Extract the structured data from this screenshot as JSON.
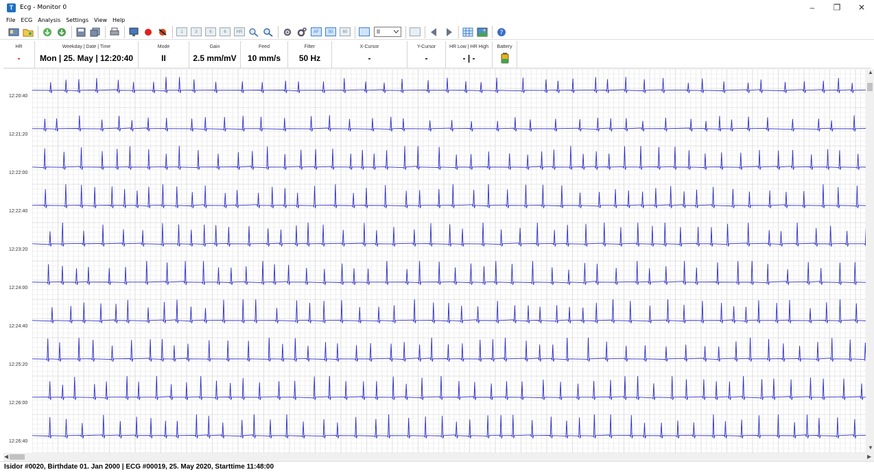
{
  "window": {
    "title": "Ecg - Monitor 0",
    "app_icon_letter": "T",
    "minimize": "–",
    "maximize": "❐",
    "close": "✕"
  },
  "menu": [
    "File",
    "ECG",
    "Analysis",
    "Settings",
    "View",
    "Help"
  ],
  "toolbar": {
    "box_labels": [
      "1",
      "3",
      "6",
      "6",
      "HR"
    ],
    "af_label": "AF",
    "b50_label": "50",
    "b60_label": "60",
    "lead_select": "II"
  },
  "header": {
    "hr_label": "HR",
    "hr_value": "-",
    "datetime_label": "Weekday | Date | Time",
    "datetime_value": "Mon | 25. May | 12:20:40",
    "mode_label": "Mode",
    "mode_value": "II",
    "gain_label": "Gain",
    "gain_value": "2.5 mm/mV",
    "feed_label": "Feed",
    "feed_value": "10 mm/s",
    "filter_label": "Filter",
    "filter_value": "50 Hz",
    "xcursor_label": "X-Cursor",
    "xcursor_value": "-",
    "ycursor_label": "Y-Cursor",
    "ycursor_value": "-",
    "hrlowhigh_label": "HR Low | HR High",
    "hrlowhigh_value": "- | -",
    "battery_label": "Battery"
  },
  "strips": [
    {
      "time": "12:20:40"
    },
    {
      "time": "12:21:20"
    },
    {
      "time": "12:22:00"
    },
    {
      "time": "12:22:40"
    },
    {
      "time": "12:23:20"
    },
    {
      "time": "12:24:00"
    },
    {
      "time": "12:24:40"
    },
    {
      "time": "12:25:20"
    },
    {
      "time": "12:26:00"
    },
    {
      "time": "12:26:40"
    }
  ],
  "status": {
    "text": "Isidor #0020, Birthdate 01. Jan 2000 | ECG #00019, 25. May 2020, Starttime 11:48:00"
  },
  "colors": {
    "ecg_trace": "#2e2ec8",
    "grid_minor": "#e3e3e3",
    "grid_major": "#c8c8c8",
    "hr_value": "#e00000"
  }
}
